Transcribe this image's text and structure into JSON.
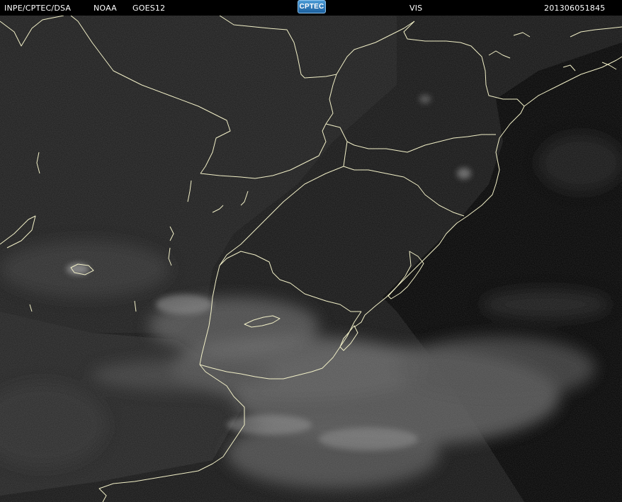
{
  "header": {
    "agency": "INPE/CPTEC/DSA",
    "provider": "NOAA",
    "satellite": "GOES12",
    "logo_text": "CPTEC",
    "channel": "VIS",
    "timestamp": "201306051845"
  },
  "colors": {
    "background": "#000000",
    "land_night": "#1c1c1c",
    "ocean_dark": "#050505",
    "cloud": "#8a8a8a",
    "border_line": "#f2f0c8",
    "text": "#ffffff"
  }
}
